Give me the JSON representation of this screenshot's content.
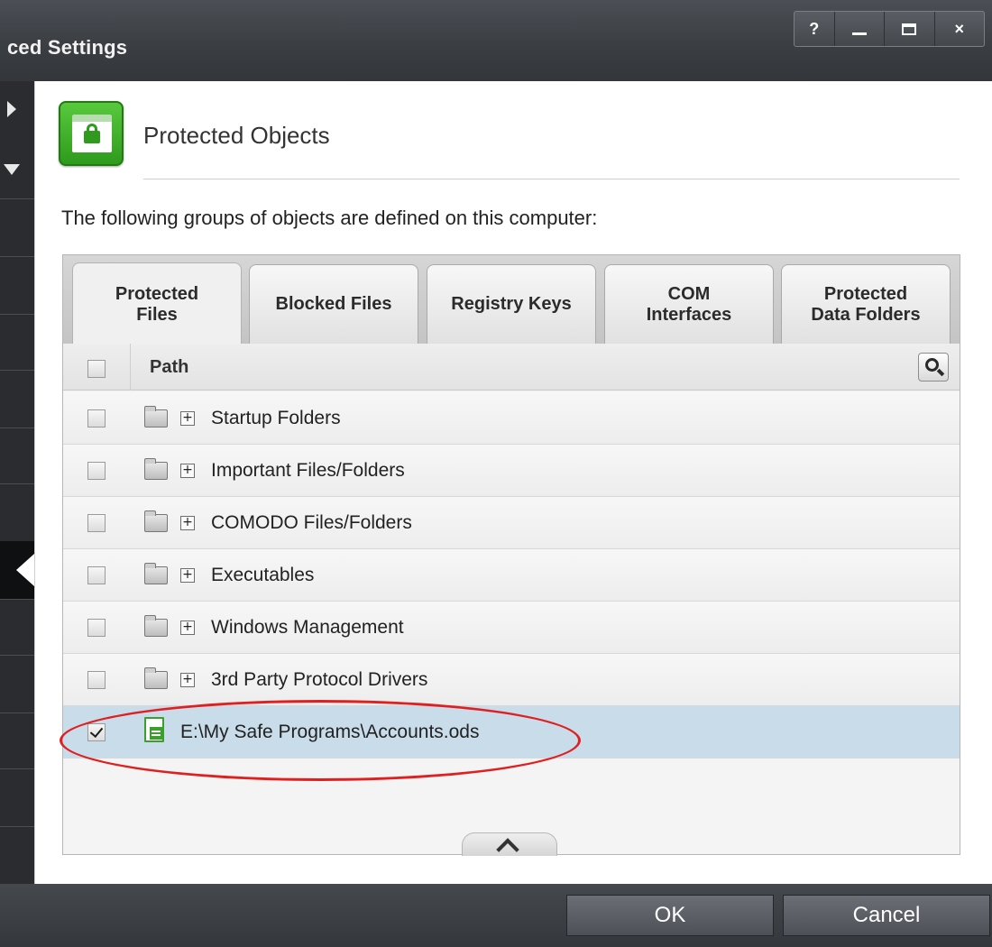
{
  "window": {
    "title": "ced Settings",
    "buttons": {
      "help": "?",
      "close": "×"
    }
  },
  "panel": {
    "title": "Protected Objects",
    "intro": "The following groups of objects are defined on this computer:"
  },
  "tabs": [
    {
      "label": "Protected Files",
      "active": true
    },
    {
      "label": "Blocked Files",
      "active": false
    },
    {
      "label": "Registry Keys",
      "active": false
    },
    {
      "label": "COM Interfaces",
      "active": false
    },
    {
      "label": "Protected Data Folders",
      "active": false
    }
  ],
  "grid": {
    "column_header": "Path",
    "rows": [
      {
        "label": "Startup Folders",
        "type": "group",
        "checked": false
      },
      {
        "label": "Important Files/Folders",
        "type": "group",
        "checked": false
      },
      {
        "label": "COMODO Files/Folders",
        "type": "group",
        "checked": false
      },
      {
        "label": "Executables",
        "type": "group",
        "checked": false
      },
      {
        "label": "Windows Management",
        "type": "group",
        "checked": false
      },
      {
        "label": "3rd Party Protocol Drivers",
        "type": "group",
        "checked": false
      },
      {
        "label": "E:\\My Safe Programs\\Accounts.ods",
        "type": "file",
        "checked": true,
        "selected": true
      }
    ],
    "expander_symbol": "+"
  },
  "footer": {
    "ok_label": "OK",
    "cancel_label": "Cancel"
  },
  "colors": {
    "accent_green": "#2f9a1d",
    "selection": "#c8dcea",
    "highlight_ellipse": "#e02020"
  }
}
